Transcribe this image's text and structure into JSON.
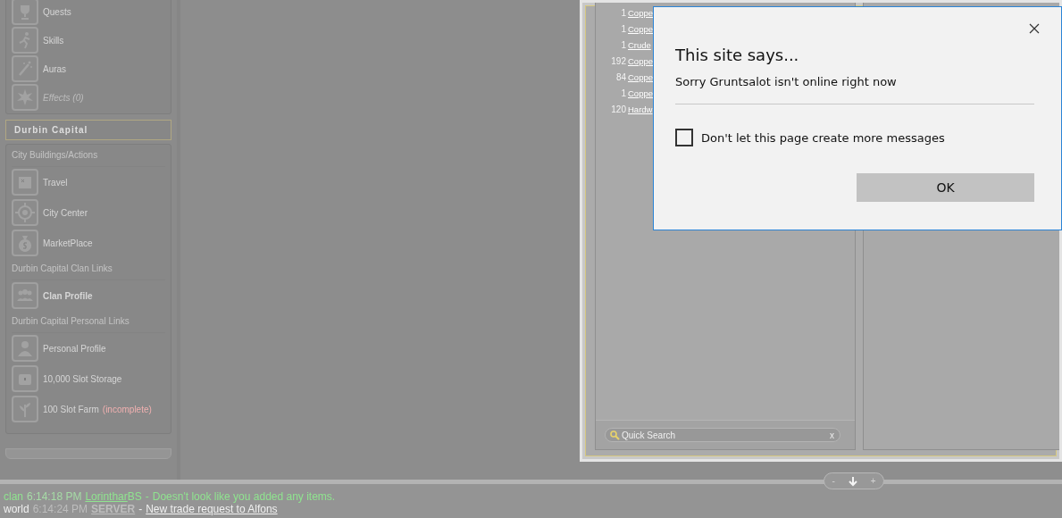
{
  "sidebar": {
    "top_items": [
      {
        "label": "Quests",
        "disabled": false,
        "highlighted": false
      },
      {
        "label": "Skills",
        "disabled": false,
        "highlighted": false
      },
      {
        "label": "Auras",
        "disabled": false,
        "highlighted": false
      },
      {
        "label": "Effects (0)",
        "disabled": true,
        "highlighted": false
      }
    ],
    "location": "Durbin Capital",
    "sections": [
      {
        "heading": "City Buildings/Actions",
        "items": [
          {
            "label": "Travel",
            "disabled": false,
            "highlighted": false
          },
          {
            "label": "City Center",
            "disabled": false,
            "highlighted": false
          },
          {
            "label": "MarketPlace",
            "disabled": false,
            "highlighted": false
          }
        ]
      },
      {
        "heading": "Durbin Capital Clan Links",
        "items": [
          {
            "label": "Clan Profile",
            "disabled": false,
            "highlighted": true
          }
        ]
      },
      {
        "heading": "Durbin Capital Personal Links",
        "items": [
          {
            "label": "Personal Profile",
            "disabled": false,
            "highlighted": false
          },
          {
            "label": "10,000 Slot Storage",
            "disabled": false,
            "highlighted": false
          },
          {
            "label": "100 Slot Farm",
            "note": "(incomplete)",
            "disabled": false,
            "highlighted": false
          }
        ]
      }
    ]
  },
  "inventory": {
    "items": [
      {
        "quantity": "1",
        "name": "Coppe"
      },
      {
        "quantity": "1",
        "name": "Coppe"
      },
      {
        "quantity": "1",
        "name": "Crude"
      },
      {
        "quantity": "192",
        "name": "Coppe"
      },
      {
        "quantity": "84",
        "name": "Coppe"
      },
      {
        "quantity": "1",
        "name": "Coppe"
      },
      {
        "quantity": "120",
        "name": "Hardw"
      }
    ],
    "quick_search": {
      "placeholder": "Quick Search",
      "clear": "x"
    }
  },
  "zoom_controls": {
    "minus": "-",
    "plus": "+"
  },
  "chat": [
    {
      "channel": "clan",
      "time": "6:14:18 PM",
      "sender": "Lorinthar",
      "sender_suffix": "BS",
      "separator": "-",
      "message": "Doesn't look like you added any items.",
      "message_is_link": false
    },
    {
      "channel": "world",
      "time": "6:14:24 PM",
      "sender": "SERVER",
      "separator": "-",
      "message": "New trade request to Alfons",
      "message_is_link": true
    }
  ],
  "dialog": {
    "title": "This site says...",
    "message": "Sorry Gruntsalot isn't online right now",
    "checkbox": {
      "label": "Don't let this page create more messages",
      "checked": false
    },
    "buttons": [
      "OK"
    ]
  }
}
